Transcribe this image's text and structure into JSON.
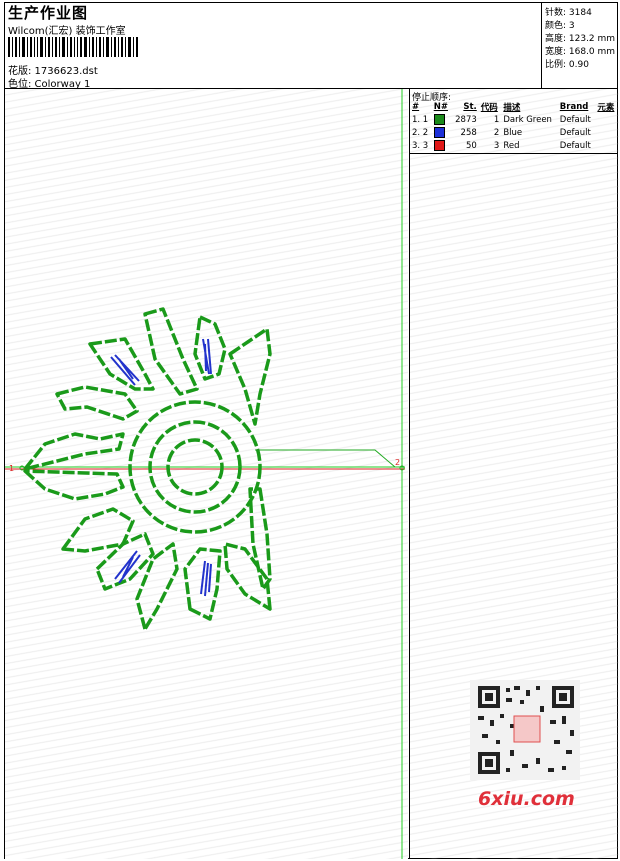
{
  "header": {
    "title": "生产作业图",
    "company": "Wilcom(汇宏) 装饰工作室",
    "design_line": "花版: 1736623.dst",
    "colorway_line": "色位: Colorway 1"
  },
  "stats": [
    "针数: 3184",
    "颜色: 3",
    "高度: 123.2 mm",
    "宽度: 168.0 mm",
    "比例: 0.90"
  ],
  "stop_sequence": {
    "title": "停止顺序:",
    "columns": [
      "#",
      "N#",
      "St.",
      "代码",
      "描述",
      "Brand",
      "元素"
    ],
    "rows": [
      {
        "idx": "1. 1",
        "swatch": "#1a8a1a",
        "stitches": "2873",
        "code": "1",
        "desc": "Dark Green",
        "brand": "Default"
      },
      {
        "idx": "2. 2",
        "swatch": "#1c2fd8",
        "stitches": "258",
        "code": "2",
        "desc": "Blue",
        "brand": "Default"
      },
      {
        "idx": "3. 3",
        "swatch": "#e01818",
        "stitches": "50",
        "code": "3",
        "desc": "Red",
        "brand": "Default"
      }
    ]
  },
  "markers": {
    "start": "1",
    "end": "2"
  },
  "colors": {
    "thread_green": "#1a9a1a",
    "thread_blue": "#2233cc",
    "guide_green": "#22cc22",
    "guide_red": "#dd2222"
  },
  "watermark": {
    "text": "6xiu.com",
    "stamp": "以图图图"
  }
}
